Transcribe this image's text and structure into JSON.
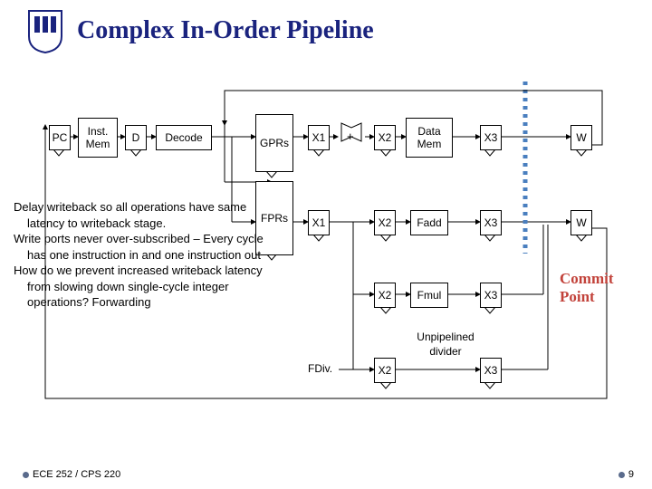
{
  "title": "Complex In-Order Pipeline",
  "footer": "ECE 252 / CPS 220",
  "pagenum": "9",
  "commit": "Commit\nPoint",
  "body": {
    "p1": "Delay writeback so all operations have same latency to writeback stage.",
    "p2": "Write ports never over-subscribed – Every cycle has one instruction in and one instruction out",
    "p3": "How do we prevent increased writeback latency from slowing down single-cycle integer operations?  Forwarding"
  },
  "stages": {
    "pc": "PC",
    "imem": "Inst.\nMem",
    "d": "D",
    "decode": "Decode",
    "gprs": "GPRs",
    "fprs": "FPRs",
    "x1": "X1",
    "plus": "+",
    "x2": "X2",
    "dmem": "Data\nMem",
    "x3": "X3",
    "w": "W",
    "fadd": "Fadd",
    "fmul": "Fmul",
    "fdiv": "FDiv.",
    "updiv": "Unpipelined\ndivider"
  }
}
